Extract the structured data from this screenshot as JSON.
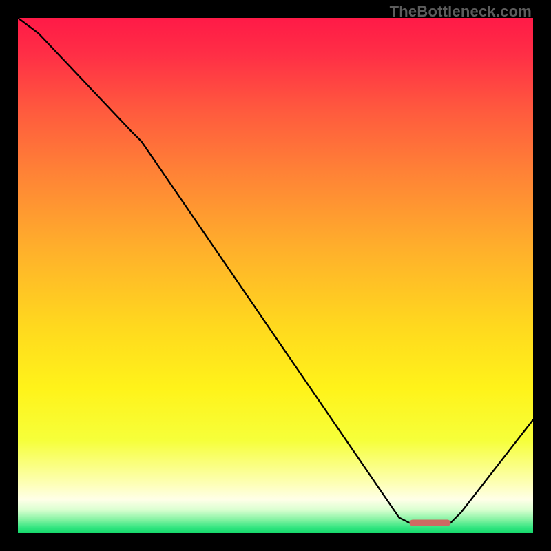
{
  "watermark": "TheBottleneck.com",
  "chart_data": {
    "type": "line",
    "title": "",
    "xlabel": "",
    "ylabel": "",
    "xlim": [
      0,
      100
    ],
    "ylim": [
      0,
      100
    ],
    "grid": false,
    "series": [
      {
        "name": "curve",
        "x": [
          0,
          4,
          22,
          24,
          74,
          76,
          84,
          86,
          100
        ],
        "values": [
          100,
          97,
          78,
          76,
          3,
          2,
          2,
          4,
          22
        ]
      }
    ],
    "marker": {
      "name": "optimal-range",
      "x_start": 76,
      "x_end": 84,
      "y": 2,
      "color": "#cf6a63"
    },
    "background_gradient": {
      "stops": [
        {
          "offset": 0.0,
          "color": "#ff1a47"
        },
        {
          "offset": 0.07,
          "color": "#ff2e46"
        },
        {
          "offset": 0.18,
          "color": "#ff5a3e"
        },
        {
          "offset": 0.3,
          "color": "#ff8236"
        },
        {
          "offset": 0.45,
          "color": "#ffb02b"
        },
        {
          "offset": 0.6,
          "color": "#ffd91e"
        },
        {
          "offset": 0.72,
          "color": "#fff31a"
        },
        {
          "offset": 0.82,
          "color": "#f6ff3a"
        },
        {
          "offset": 0.9,
          "color": "#fdffb0"
        },
        {
          "offset": 0.935,
          "color": "#ffffe8"
        },
        {
          "offset": 0.955,
          "color": "#d9ffd0"
        },
        {
          "offset": 0.975,
          "color": "#7ff2a0"
        },
        {
          "offset": 0.99,
          "color": "#2fe57f"
        },
        {
          "offset": 1.0,
          "color": "#16d86a"
        }
      ]
    }
  }
}
